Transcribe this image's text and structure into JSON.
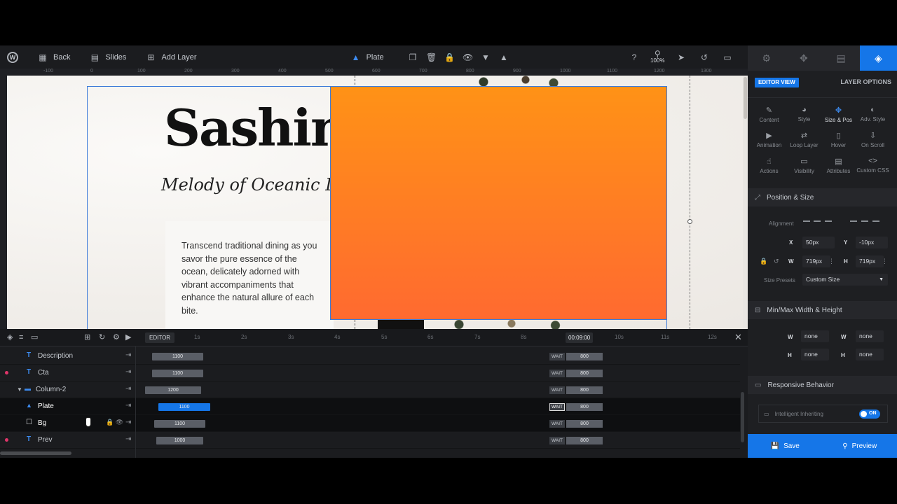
{
  "toolbar": {
    "back": "Back",
    "slides": "Slides",
    "add_layer": "Add Layer",
    "current_layer": "Plate",
    "zoom": "100%"
  },
  "ruler": {
    "ticks": [
      "-100",
      "0",
      "100",
      "200",
      "300",
      "400",
      "500",
      "600",
      "700",
      "800",
      "900",
      "1000",
      "1100",
      "1200",
      "1300"
    ]
  },
  "canvas": {
    "title": "Sashin",
    "subtitle": "Melody of Oceanic D",
    "description": "Transcend traditional dining as you savor the pure essence of the ocean, delicately adorned with vibrant accompaniments that enhance the natural allure of each bite.",
    "plate_color_top": "#ff9216",
    "plate_color_bottom": "#ff6a30"
  },
  "timeline": {
    "editor_tab": "EDITOR",
    "time": "00:09:00",
    "ticks": [
      "1s",
      "2s",
      "3s",
      "4s",
      "5s",
      "6s",
      "7s",
      "8s",
      "10s",
      "11s",
      "12s"
    ],
    "rows": [
      {
        "label": "Description",
        "type": "T",
        "bar": "1100",
        "wait": "WAIT",
        "out": "800"
      },
      {
        "label": "Cta",
        "type": "T",
        "bar": "1100",
        "wait": "WAIT",
        "out": "800"
      },
      {
        "label": "Column-2",
        "type": "col",
        "bar": "1200",
        "wait": "WAIT",
        "out": "800"
      },
      {
        "label": "Plate",
        "type": "shape",
        "bar": "1100",
        "wait": "WAIT",
        "out": "800"
      },
      {
        "label": "Bg",
        "type": "box",
        "bar": "1100",
        "wait": "WAIT",
        "out": "800"
      },
      {
        "label": "Prev",
        "type": "T",
        "bar": "1000",
        "wait": "WAIT",
        "out": "800"
      }
    ]
  },
  "panel": {
    "editor_view": "EDITOR VIEW",
    "layer_options": "LAYER OPTIONS",
    "grid": [
      {
        "label": "Content",
        "icon": "pen-icon"
      },
      {
        "label": "Style",
        "icon": "palette-icon"
      },
      {
        "label": "Size & Pos",
        "icon": "move-icon"
      },
      {
        "label": "Adv. Style",
        "icon": "contrast-icon"
      },
      {
        "label": "Animation",
        "icon": "play-icon"
      },
      {
        "label": "Loop Layer",
        "icon": "loop-icon"
      },
      {
        "label": "Hover",
        "icon": "mouse-icon"
      },
      {
        "label": "On Scroll",
        "icon": "scroll-icon"
      },
      {
        "label": "Actions",
        "icon": "hand-icon"
      },
      {
        "label": "Visibility",
        "icon": "visibility-icon"
      },
      {
        "label": "Attributes",
        "icon": "document-icon"
      },
      {
        "label": "Custom CSS",
        "icon": "code-icon"
      }
    ],
    "position_size": "Position & Size",
    "alignment": "Alignment",
    "x_label": "X",
    "x_value": "50px",
    "y_label": "Y",
    "y_value": "-10px",
    "w_label": "W",
    "w_value": "719px",
    "h_label": "H",
    "h_value": "719px",
    "size_presets": "Size Presets",
    "size_preset_value": "Custom Size",
    "minmax": "Min/Max Width & Height",
    "min_w": "none",
    "max_w": "none",
    "min_h": "none",
    "max_h": "none",
    "responsive": "Responsive Behavior",
    "intelligent": "Intelligent Inheriting",
    "toggle": "ON",
    "save": "Save",
    "preview": "Preview"
  }
}
